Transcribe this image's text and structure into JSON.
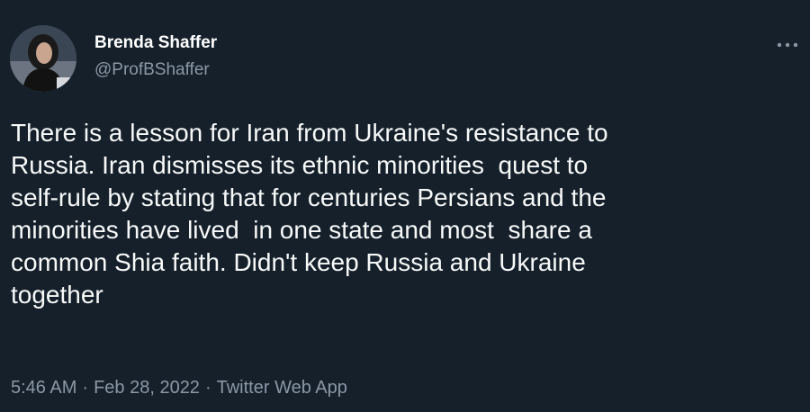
{
  "author": {
    "display_name": "Brenda Shaffer",
    "handle": "@ProfBShaffer"
  },
  "icons": {
    "avatar": "user-avatar-photo",
    "more": "more-horizontal-icon"
  },
  "tweet": {
    "text": "There is a lesson for Iran from Ukraine's resistance to\nRussia. Iran dismisses its ethnic minorities  quest to\nself-rule by stating that for centuries Persians and the\nminorities have lived  in one state and most  share a\ncommon Shia faith. Didn't keep Russia and Ukraine\ntogether"
  },
  "meta": {
    "time": "5:46 AM",
    "separator": "·",
    "date": "Feb 28, 2022",
    "source": "Twitter Web App"
  },
  "colors": {
    "background": "#15202b",
    "primary_text": "#f7f9f9",
    "secondary_text": "#8b98a5"
  }
}
